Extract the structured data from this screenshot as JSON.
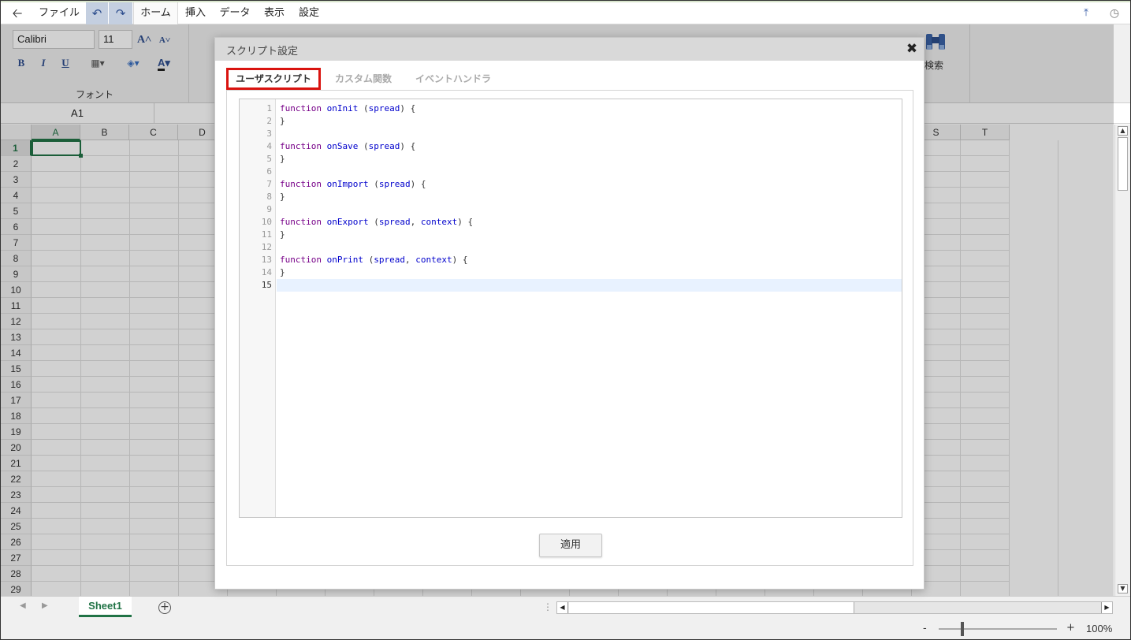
{
  "menubar": {
    "items": [
      "ファイル",
      "ホーム",
      "挿入",
      "データ",
      "表示",
      "設定"
    ]
  },
  "ribbon": {
    "font_name": "Calibri",
    "font_size": "11",
    "bold": "B",
    "italic": "I",
    "underline": "U",
    "font_color_letter": "A",
    "font_group_label": "フォント",
    "search_label": "検索"
  },
  "formula_bar": {
    "cell_ref": "A1"
  },
  "grid": {
    "columns": [
      "A",
      "B",
      "C",
      "D",
      "S",
      "T"
    ],
    "rows": [
      "1",
      "2",
      "3",
      "4",
      "5",
      "6",
      "7",
      "8",
      "9",
      "10",
      "11",
      "12",
      "13",
      "14",
      "15",
      "16",
      "17",
      "18",
      "19",
      "20",
      "21",
      "22",
      "23",
      "24",
      "25",
      "26",
      "27",
      "28",
      "29"
    ]
  },
  "sheet_tabs": {
    "active": "Sheet1"
  },
  "status": {
    "zoom_minus": "-",
    "zoom_plus": "+",
    "zoom": "100%",
    "zoom_level": 1.0
  },
  "dialog": {
    "title": "スクリプト設定",
    "close_label": "✖",
    "tabs": [
      "ユーザスクリプト",
      "カスタム関数",
      "イベントハンドラ"
    ],
    "active_tab": "ユーザスクリプト",
    "apply_label": "適用",
    "code_lines": [
      "function onInit (spread) {",
      "}",
      "",
      "function onSave (spread) {",
      "}",
      "",
      "function onImport (spread) {",
      "}",
      "",
      "function onExport (spread, context) {",
      "}",
      "",
      "function onPrint (spread, context) {",
      "}",
      ""
    ]
  },
  "colors": {
    "accent_green": "#217346",
    "tab_highlight_red": "#d9130f",
    "keyword_purple": "#770088",
    "identifier_blue": "#0000cc"
  }
}
